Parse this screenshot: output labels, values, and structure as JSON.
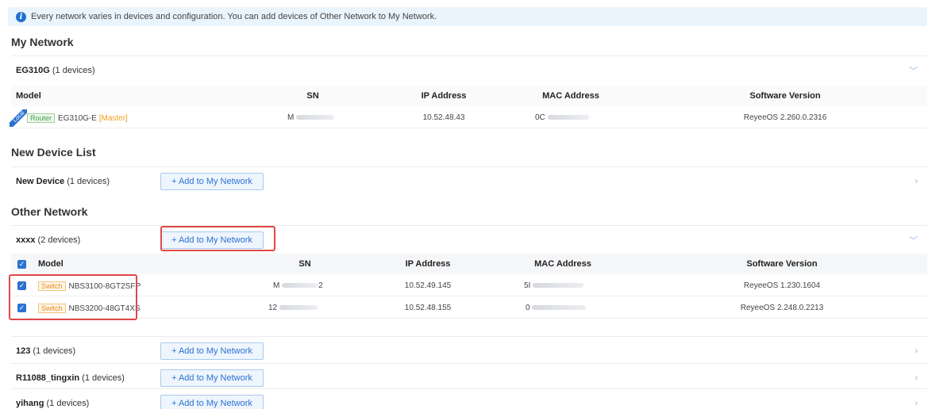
{
  "notice": {
    "icon": "info-icon",
    "text": "Every network varies in devices and configuration. You can add devices of Other Network to My Network."
  },
  "sections": {
    "my_network": "My Network",
    "new_device_list": "New Device List",
    "other_network": "Other Network"
  },
  "add_button_label": "+ Add to My Network",
  "columns": {
    "model": "Model",
    "sn": "SN",
    "ip": "IP Address",
    "mac": "MAC Address",
    "software": "Software Version"
  },
  "my_network": {
    "group": {
      "name": "EG310G",
      "count": "(1 devices)"
    },
    "device": {
      "badge": "Local",
      "type": "Router",
      "model": "EG310G-E",
      "role": "[Master]",
      "sn": "M",
      "ip": "10.52.48.43",
      "mac": "0C",
      "software": "ReyeeOS 2.260.0.2316"
    }
  },
  "new_device": {
    "name": "New Device",
    "count": "(1 devices)"
  },
  "other_groups": [
    {
      "name": "xxxx",
      "count": "(2 devices)"
    },
    {
      "name": "123",
      "count": "(1 devices)"
    },
    {
      "name": "R11088_tingxin",
      "count": "(1 devices)"
    },
    {
      "name": "yihang",
      "count": "(1 devices)"
    }
  ],
  "xxxx_devices": [
    {
      "type": "Switch",
      "model": "NBS3100-8GT2SFP",
      "sn": "M",
      "sn_tail": "2",
      "ip": "10.52.49.145",
      "mac": "5I",
      "software": "ReyeeOS 1.230.1604"
    },
    {
      "type": "Switch",
      "model": "NBS3200-48GT4XS",
      "sn": "12",
      "sn_tail": "",
      "ip": "10.52.48.155",
      "mac": "0",
      "software": "ReyeeOS 2.248.0.2213"
    }
  ],
  "colors": {
    "accent": "#2b72d1",
    "highlight": "#e04848",
    "router_tag": "#3f9a3f",
    "switch_tag": "#e58a1a"
  }
}
